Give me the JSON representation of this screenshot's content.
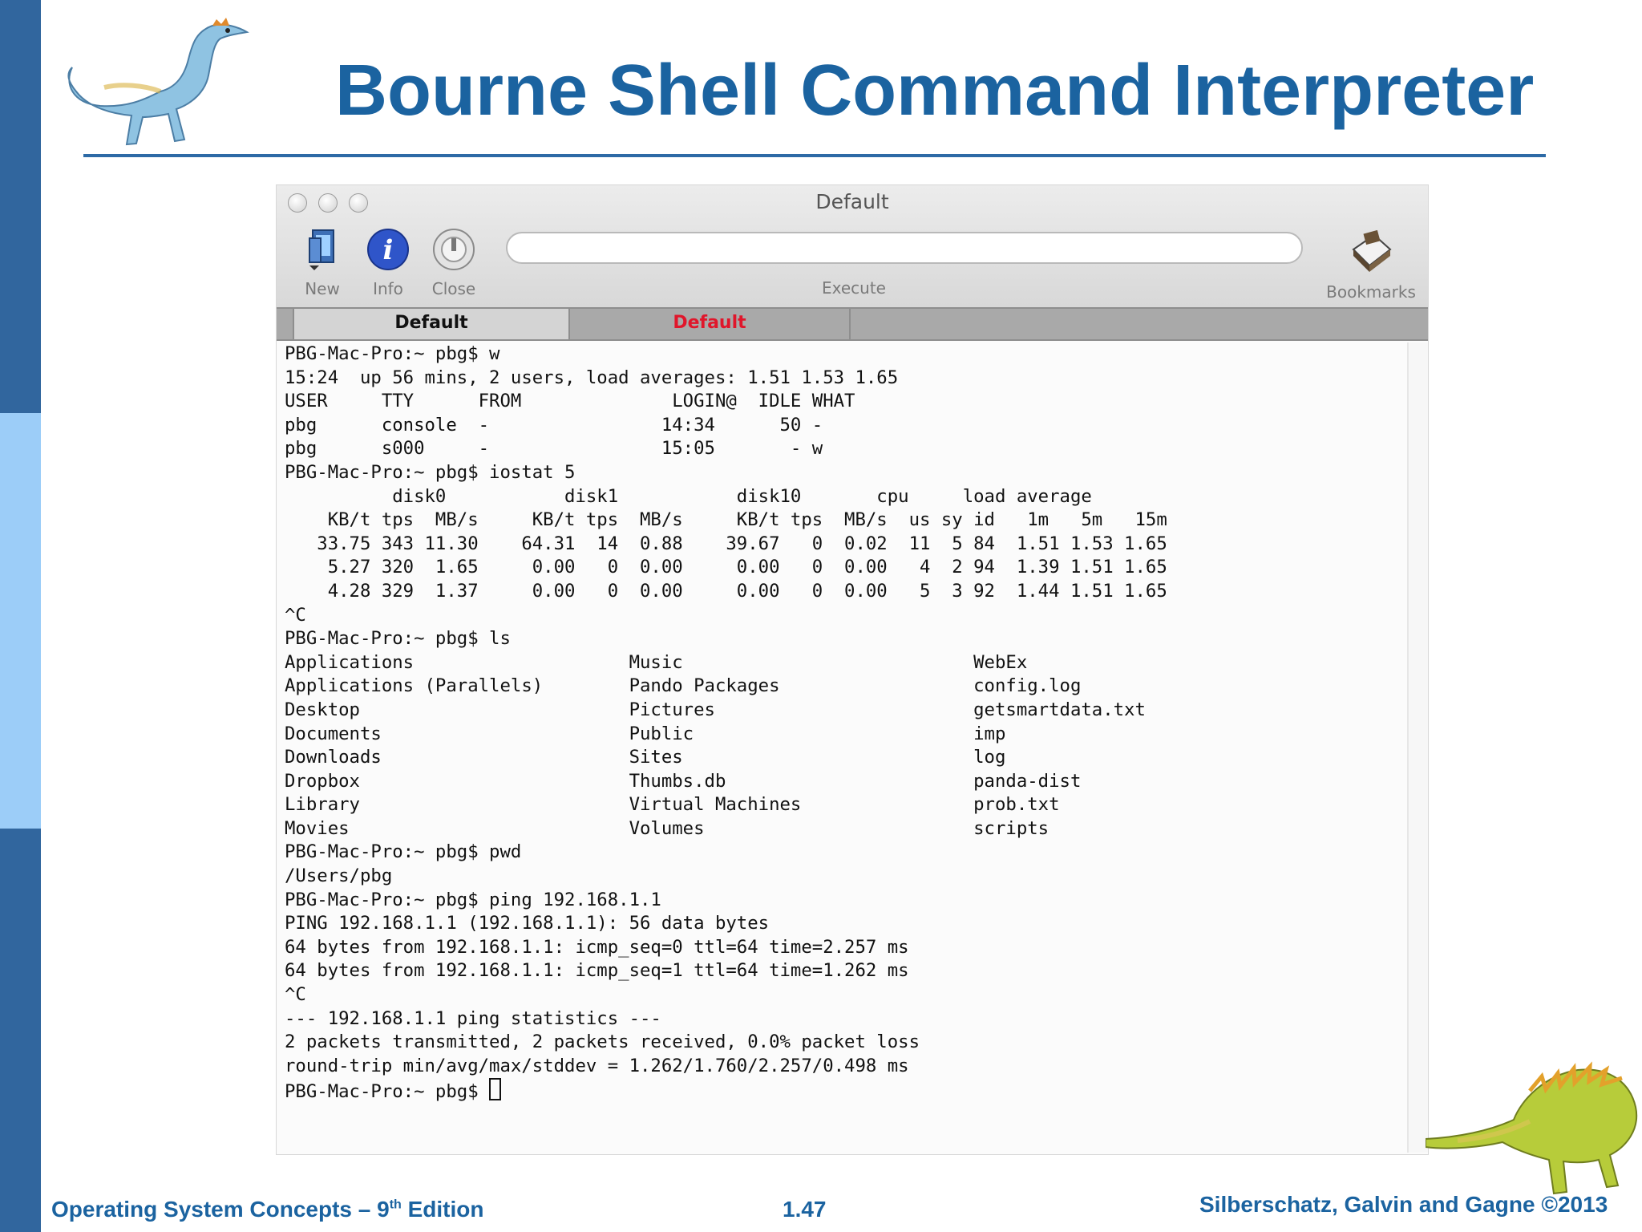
{
  "slide": {
    "title": "Bourne Shell Command Interpreter",
    "footer_left_pre": "Operating System Concepts – 9",
    "footer_left_sup": "th",
    "footer_left_post": " Edition",
    "footer_center": "1.47",
    "footer_right": "Silberschatz, Galvin and Gagne ©2013"
  },
  "window": {
    "title": "Default",
    "toolbar": {
      "new": "New",
      "info": "Info",
      "close": "Close",
      "execute": "Execute",
      "bookmarks": "Bookmarks"
    },
    "tabs": [
      "Default",
      "Default"
    ],
    "colors": {
      "inactive_tab_text": "#e0162b",
      "title_blue": "#1b63a0"
    }
  },
  "terminal": {
    "lines": [
      "PBG-Mac-Pro:~ pbg$ w",
      "15:24  up 56 mins, 2 users, load averages: 1.51 1.53 1.65",
      "USER     TTY      FROM              LOGIN@  IDLE WHAT",
      "pbg      console  -                14:34      50 -",
      "pbg      s000     -                15:05       - w",
      "PBG-Mac-Pro:~ pbg$ iostat 5",
      "          disk0           disk1           disk10       cpu     load average",
      "    KB/t tps  MB/s     KB/t tps  MB/s     KB/t tps  MB/s  us sy id   1m   5m   15m",
      "   33.75 343 11.30    64.31  14  0.88    39.67   0  0.02  11  5 84  1.51 1.53 1.65",
      "    5.27 320  1.65     0.00   0  0.00     0.00   0  0.00   4  2 94  1.39 1.51 1.65",
      "    4.28 329  1.37     0.00   0  0.00     0.00   0  0.00   5  3 92  1.44 1.51 1.65",
      "^C",
      "PBG-Mac-Pro:~ pbg$ ls",
      "Applications                    Music                           WebEx",
      "Applications (Parallels)        Pando Packages                  config.log",
      "Desktop                         Pictures                        getsmartdata.txt",
      "Documents                       Public                          imp",
      "Downloads                       Sites                           log",
      "Dropbox                         Thumbs.db                       panda-dist",
      "Library                         Virtual Machines                prob.txt",
      "Movies                          Volumes                         scripts",
      "PBG-Mac-Pro:~ pbg$ pwd",
      "/Users/pbg",
      "PBG-Mac-Pro:~ pbg$ ping 192.168.1.1",
      "PING 192.168.1.1 (192.168.1.1): 56 data bytes",
      "64 bytes from 192.168.1.1: icmp_seq=0 ttl=64 time=2.257 ms",
      "64 bytes from 192.168.1.1: icmp_seq=1 ttl=64 time=1.262 ms",
      "^C",
      "--- 192.168.1.1 ping statistics ---",
      "2 packets transmitted, 2 packets received, 0.0% packet loss",
      "round-trip min/avg/max/stddev = 1.262/1.760/2.257/0.498 ms",
      "PBG-Mac-Pro:~ pbg$ "
    ]
  }
}
